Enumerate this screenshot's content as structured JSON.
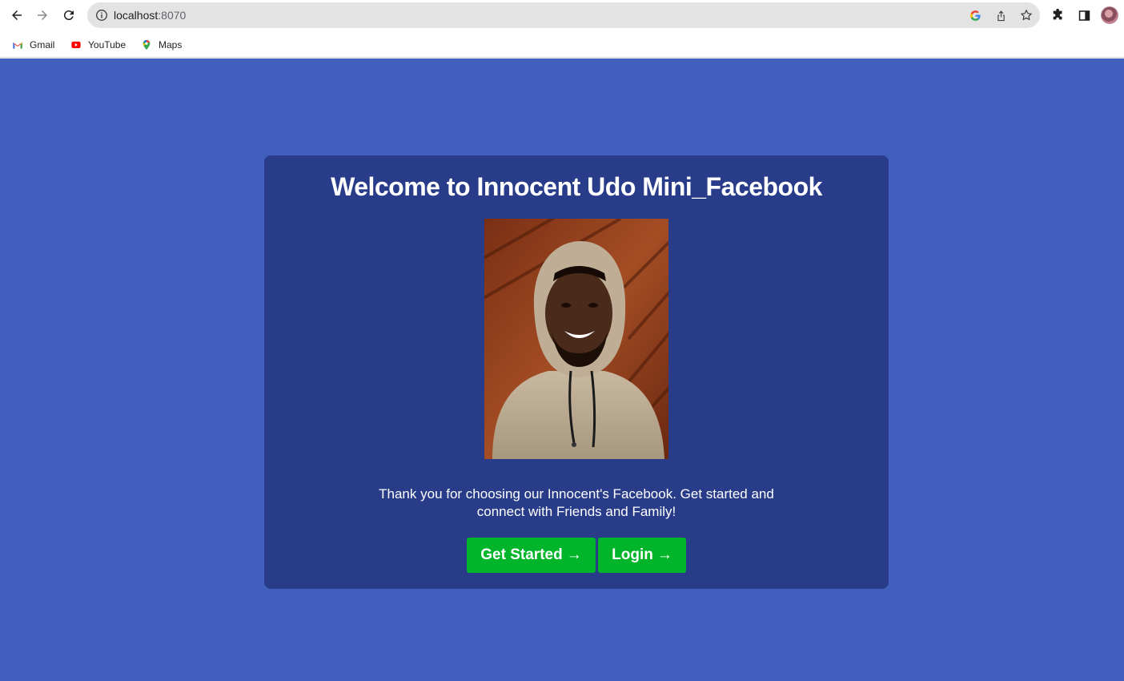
{
  "browser": {
    "url_host": "localhost",
    "url_port": ":8070",
    "bookmarks": [
      {
        "label": "Gmail",
        "icon": "gmail-icon"
      },
      {
        "label": "YouTube",
        "icon": "youtube-icon"
      },
      {
        "label": "Maps",
        "icon": "maps-icon"
      }
    ]
  },
  "page": {
    "background": "#415fbd",
    "card_background": "#283c89",
    "title": "Welcome to Innocent Udo Mini_Facebook",
    "photo_alt": "profile-photo",
    "description": "Thank you for choosing our Innocent's Facebook. Get started and connect with Friends and Family!",
    "buttons": {
      "get_started": "Get Started",
      "login": "Login",
      "arrow": "→",
      "color": "#00b52a"
    }
  }
}
